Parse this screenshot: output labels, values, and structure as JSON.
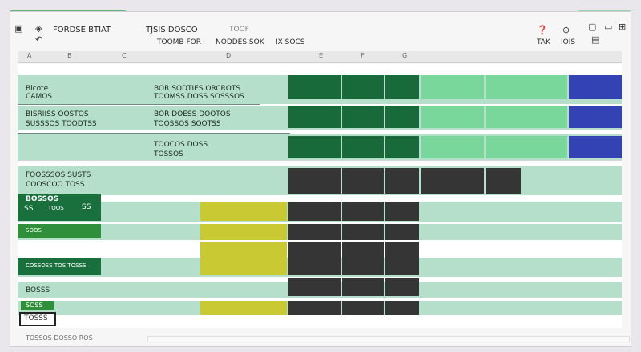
{
  "toolbar": {
    "title": "FORDSE BTIAT",
    "menu1": "TJSIS DOSCO",
    "menu2": "TOOMB FOR",
    "menu3": "NODDES SOK",
    "menu4": "IX SOCS",
    "menu5": "TOOF",
    "right1": "TAK",
    "right2": "IOIS"
  },
  "col_letters": [
    "A",
    "B",
    "C",
    "D",
    "E",
    "F",
    "G"
  ],
  "rows": {
    "r1_left": "Bicote",
    "r1_left2": "CAMOS",
    "r1_mid": "BOR SODTIES ORCROTS",
    "r1_mid2": "TOOMSS DOSS SOSSSOS",
    "r2_left": "BISRIISS OOSTOS",
    "r2_left2": "SUSSSOS TOODTSS",
    "r2_mid": "BOR DOESS DOOTOS",
    "r2_mid2": "TOOSSOS SOOTSS",
    "r3_mid": "TOOCOS DOSS",
    "r3_mid2": "TOSSOS",
    "r4_left": "FOOSSSOS SUSTS",
    "r4_left2": "COOSCOO TOSS",
    "r5_head": "BOSSOS",
    "r5_num": "SS",
    "r5_num2": "SS",
    "r5_sub": "TOOS",
    "r6_label": "SOOS",
    "r7_label": "COSSOSS TOS TOSSS",
    "r8_label": "BOSSS",
    "r9_label": "SOSS",
    "selected_cell": "TOSSS"
  },
  "status": {
    "label": "TOSSOS DOSSO ROS"
  }
}
